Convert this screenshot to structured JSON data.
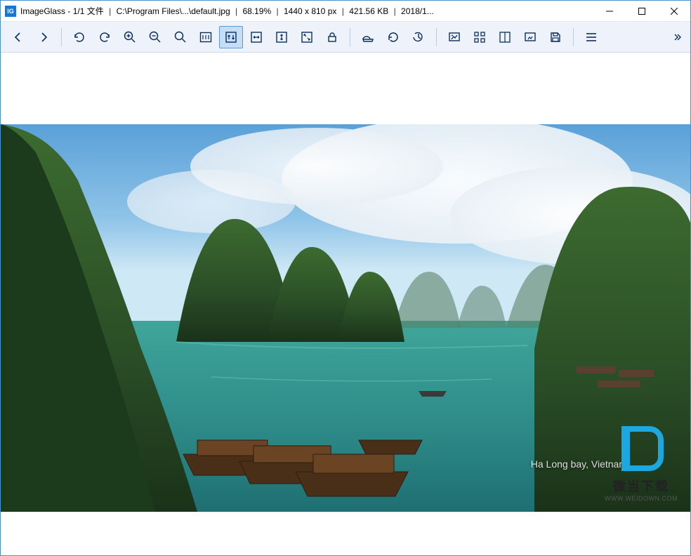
{
  "titlebar": {
    "app": "ImageGlass",
    "counter": "1/1 文件",
    "path": "C:\\Program Files\\...\\default.jpg",
    "zoom": "68.19%",
    "dimensions": "1440 x 810 px",
    "filesize": "421.56 KB",
    "date": "2018/1..."
  },
  "window_controls": {
    "minimize": "minimize",
    "maximize": "maximize",
    "close": "close"
  },
  "toolbar": {
    "groups": [
      [
        "previous-image",
        "next-image"
      ],
      [
        "rotate-ccw",
        "rotate-cw",
        "zoom-in",
        "zoom-out",
        "zoom-tool",
        "actual-size",
        "fit-height",
        "fit-horizontal",
        "fit-width",
        "fit-window",
        "lock-zoom"
      ],
      [
        "open-file",
        "refresh",
        "goto-image"
      ],
      [
        "slideshow",
        "thumbnails",
        "checkerboard",
        "fullscreen",
        "save"
      ],
      [
        "menu"
      ]
    ],
    "active": "fit-height"
  },
  "image": {
    "caption": "Ha Long bay, Vietnam"
  },
  "watermark": {
    "text": "微当下载",
    "url": "WWW.WEIDOWN.COM"
  }
}
